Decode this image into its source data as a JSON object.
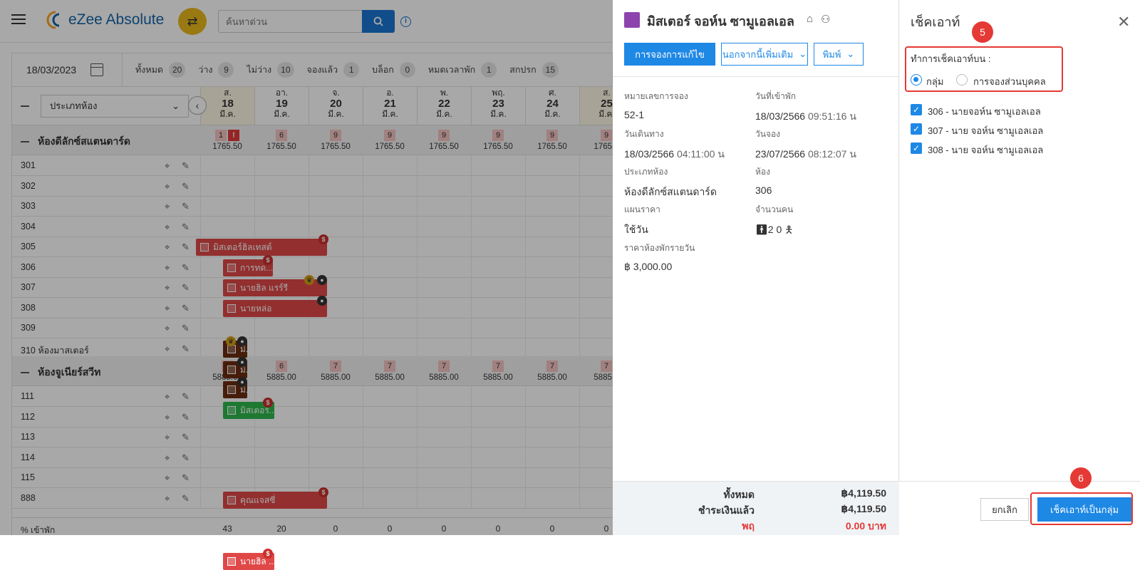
{
  "app": {
    "logo": "eZee Absolute",
    "search_placeholder": "ค้นหาด่วน"
  },
  "stats": {
    "date": "18/03/2023",
    "items": [
      {
        "label": "ทั้งหมด",
        "count": "20"
      },
      {
        "label": "ว่าง",
        "count": "9"
      },
      {
        "label": "ไม่ว่าง",
        "count": "10"
      },
      {
        "label": "จองแล้ว",
        "count": "1"
      },
      {
        "label": "บล็อก",
        "count": "0"
      },
      {
        "label": "หมดเวลาพัก",
        "count": "1"
      },
      {
        "label": "สกปรก",
        "count": "15"
      }
    ]
  },
  "grid": {
    "room_type_select": "ประเภทห้อง",
    "days": [
      {
        "dow": "ส.",
        "day": "18",
        "mon": "มี.ค."
      },
      {
        "dow": "อา.",
        "day": "19",
        "mon": "มี.ค."
      },
      {
        "dow": "จ.",
        "day": "20",
        "mon": "มี.ค."
      },
      {
        "dow": "อ.",
        "day": "21",
        "mon": "มี.ค."
      },
      {
        "dow": "พ.",
        "day": "22",
        "mon": "มี.ค."
      },
      {
        "dow": "พฤ.",
        "day": "23",
        "mon": "มี.ค."
      },
      {
        "dow": "ศ.",
        "day": "24",
        "mon": "มี.ค."
      },
      {
        "dow": "ส.",
        "day": "25",
        "mon": "มี.ค."
      }
    ],
    "sections": [
      {
        "title": "ห้องดีลักซ์สแตนดาร์ด",
        "avail": [
          "1",
          "6",
          "9",
          "9",
          "9",
          "9",
          "9",
          "9"
        ],
        "rates": [
          "1765.50",
          "1765.50",
          "1765.50",
          "1765.50",
          "1765.50",
          "1765.50",
          "1765.50",
          "1765.5"
        ],
        "rooms": [
          "301",
          "302",
          "303",
          "304",
          "305",
          "306",
          "307",
          "308",
          "309",
          "310 ห้องมาสเตอร์"
        ]
      },
      {
        "title": "ห้องจูเนียร์สวีท",
        "avail": [
          "5",
          "6",
          "7",
          "7",
          "7",
          "7",
          "7",
          "7"
        ],
        "rates": [
          "5885.00",
          "5885.00",
          "5885.00",
          "5885.00",
          "5885.00",
          "5885.00",
          "5885.00",
          "5885.0"
        ],
        "rooms": [
          "111",
          "112",
          "113",
          "114",
          "115",
          "888"
        ]
      }
    ],
    "bookings": {
      "b301": "มิสเตอร์ฮิลเทสต์",
      "b302": "การทด...",
      "b303": "นายฮิล แรร์รี",
      "b304": "นายหล่อ",
      "b306": "มิ...",
      "b307": "มิ...",
      "b308": "มิ...",
      "b309": "มิสเตอร์...",
      "b112": "คุณแจสซี่",
      "b115": "นายฮิล ..."
    },
    "footer": {
      "label": "% เข้าพัก",
      "values": [
        "43",
        "20",
        "0",
        "0",
        "0",
        "0",
        "0",
        "0"
      ]
    }
  },
  "reservation": {
    "guest_name": "มิสเตอร์ จอห์น ซามูเอลเอล",
    "edit_button": "การจองการแก้ไข",
    "more_button": "นอกจากนี้เพิ่มเติม",
    "print_button": "พิมพ์",
    "fields": {
      "res_no_label": "หมายเลขการจอง",
      "res_no": "52-1",
      "checkin_label": "วันที่เข้าพัก",
      "checkin_date": "18/03/2566",
      "checkin_time": "09:51:16 น",
      "depart_label": "วันเดินทาง",
      "depart_date": "18/03/2566",
      "depart_time": "04:11:00 น",
      "booked_label": "วันจอง",
      "booked_date": "23/07/2566",
      "booked_time": "08:12:07 น",
      "roomtype_label": "ประเภทห้อง",
      "roomtype": "ห้องดีลักซ์สแตนดาร์ด",
      "room_label": "ห้อง",
      "room": "306",
      "plan_label": "แผนราคา",
      "plan": "ใช้วัน",
      "pax_label": "จำนวนคน",
      "adults": "2",
      "children": "0",
      "rate_label": "ราคาห้องพักรายวัน",
      "rate": "฿ 3,000.00"
    },
    "totals": {
      "total_label": "ทั้งหมด",
      "total": "฿4,119.50",
      "paid_label": "ชำระเงินแล้ว",
      "paid": "฿4,119.50",
      "balance_label": "พฤ",
      "balance": "0.00 บาท"
    }
  },
  "checkout": {
    "title": "เช็คเอาท์",
    "step5": "5",
    "step6": "6",
    "mode_label": "ทำการเช็คเอาท์บน :",
    "option_group": "กลุ่ม",
    "option_individual": "การจองส่วนบุคคล",
    "rooms": [
      "306 - นายจอห์น ซามูเอลเอล",
      "307 - นาย จอห์น ซามูเอลเอล",
      "308 - นาย จอห์น ซามูเอลเอล"
    ],
    "cancel_button": "ยกเลิก",
    "group_checkout_button": "เช็คเอาท์เป็นกลุ่ม"
  },
  "colors": {
    "accent": "#1e88e5",
    "booking_red": "#e04848",
    "booking_green": "#2db84b",
    "booking_brown": "#6b2c10",
    "step_red": "#e53935"
  }
}
